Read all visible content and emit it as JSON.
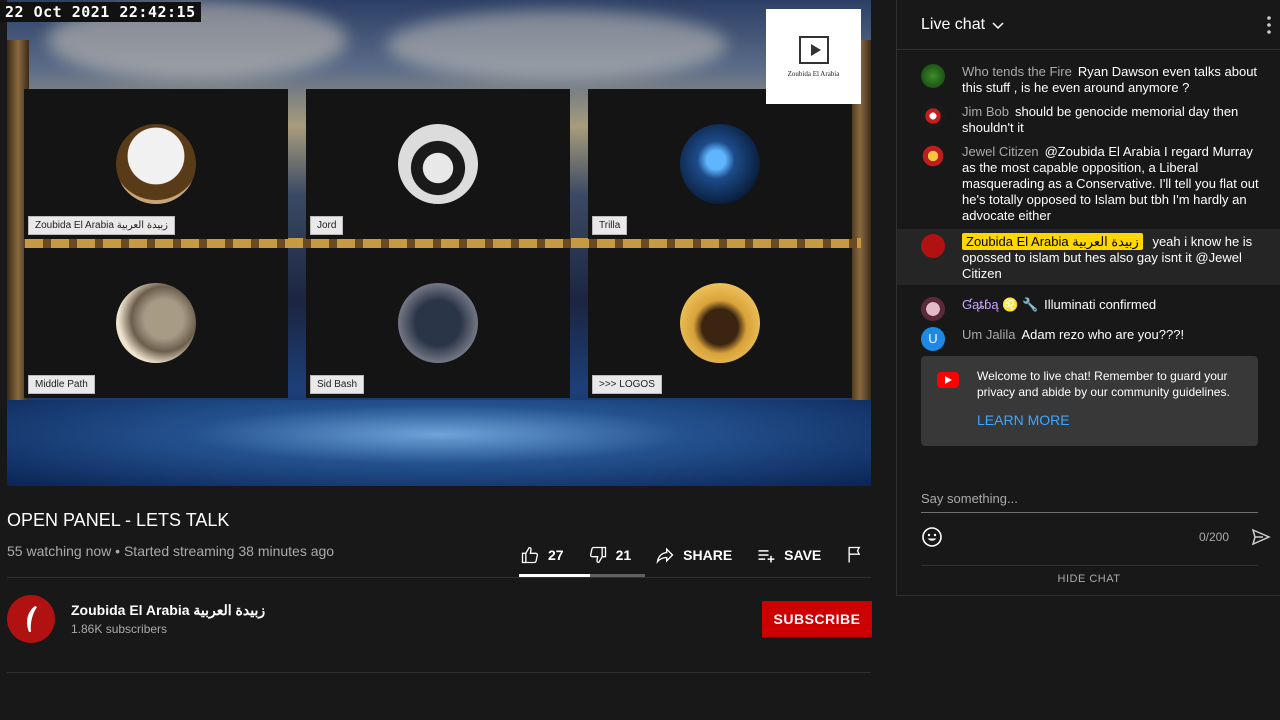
{
  "video": {
    "timestamp": "22 Oct 2021 22:42:15",
    "logo_text": "Zoubida El Arabia",
    "participants": [
      {
        "name": "Zoubida El Arabia زبيدة العربية"
      },
      {
        "name": "Jord"
      },
      {
        "name": "Trilla"
      },
      {
        "name": "Middle Path"
      },
      {
        "name": "Sid Bash"
      },
      {
        "name": ">>> LOGOS"
      }
    ]
  },
  "info": {
    "title": "OPEN PANEL - LETS TALK",
    "meta": "55 watching now • Started streaming 38 minutes ago",
    "likes": "27",
    "dislikes": "21",
    "share": "SHARE",
    "save": "SAVE",
    "like_ratio": 0.56
  },
  "channel": {
    "name": "Zoubida El Arabia زبيدة العربية",
    "subscribers": "1.86K subscribers",
    "subscribe_label": "SUBSCRIBE"
  },
  "chat": {
    "title": "Live chat",
    "messages": [
      {
        "author": "Who tends the Fire",
        "text": "Ryan Dawson even talks about this stuff , is he even around anymore ?"
      },
      {
        "author": "Jim Bob",
        "text": "should be genocide memorial day then shouldn't it"
      },
      {
        "author": "Jewel Citizen",
        "text": "@Zoubida El Arabia I regard Murray as the most capable opposition, a Liberal masquerading as a Conservative. I'll tell you flat out he's totally opposed to Islam but tbh I'm hardly an advocate either"
      },
      {
        "author": "Zoubida El Arabia زبيدة العربية",
        "text": "yeah i know he is opossed to islam but hes also gay isnt it @Jewel Citizen"
      },
      {
        "author": "Ɠąȶɓą ♌ 🔧",
        "text": "Illuminati confirmed"
      },
      {
        "author": "Um Jalila",
        "text": "Adam rezo who are you???!",
        "initial": "U"
      }
    ],
    "welcome_text": "Welcome to live chat! Remember to guard your privacy and abide by our community guidelines.",
    "learn_more": "LEARN MORE",
    "input_placeholder": "Say something...",
    "counter": "0/200",
    "hide_chat": "HIDE CHAT"
  },
  "colors": {
    "accent_red": "#cc0000",
    "link_blue": "#3ea6ff",
    "owner_badge": "#ffd600"
  }
}
